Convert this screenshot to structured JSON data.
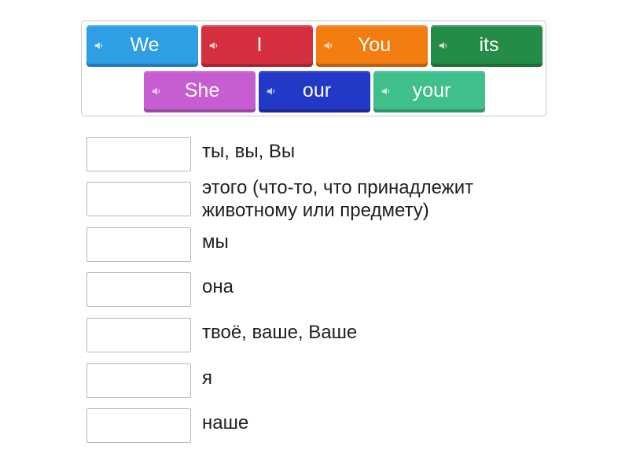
{
  "tiles": [
    {
      "label": "We",
      "color": "#2e9ee5"
    },
    {
      "label": "I",
      "color": "#d63040"
    },
    {
      "label": "You",
      "color": "#f47d12"
    },
    {
      "label": "its",
      "color": "#248c46"
    },
    {
      "label": "She",
      "color": "#c65ed1"
    },
    {
      "label": "our",
      "color": "#2238c6"
    },
    {
      "label": "your",
      "color": "#3fbf8a"
    }
  ],
  "clues": [
    "ты, вы, Вы",
    "этого (что-то, что принадлежит животному или предмету)",
    "мы",
    "она",
    "твоё, ваше, Ваше",
    "я",
    "наше"
  ]
}
